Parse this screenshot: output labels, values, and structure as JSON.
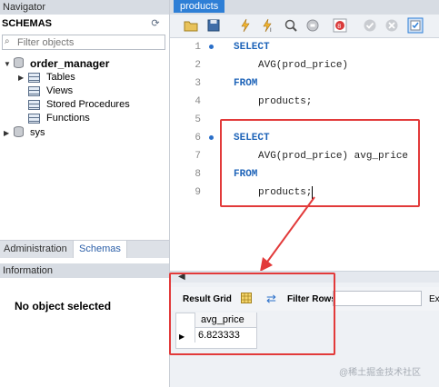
{
  "navigator": {
    "title": "Navigator",
    "schemas_label": "SCHEMAS",
    "filter_placeholder": "Filter objects",
    "tree": {
      "db_name": "order_manager",
      "children": [
        "Tables",
        "Views",
        "Stored Procedures",
        "Functions"
      ],
      "other_db": "sys"
    },
    "tabs": [
      "Administration",
      "Schemas"
    ],
    "info_title": "Information",
    "info_text": "No object selected"
  },
  "editor": {
    "tab_label": "products",
    "lines": [
      {
        "num": "1",
        "text": "SELECT"
      },
      {
        "num": "2",
        "text": "AVG(prod_price)"
      },
      {
        "num": "3",
        "text": "FROM"
      },
      {
        "num": "4",
        "text": "products;"
      },
      {
        "num": "5",
        "text": ""
      },
      {
        "num": "6",
        "text": "SELECT"
      },
      {
        "num": "7",
        "text": "AVG(prod_price) avg_price"
      },
      {
        "num": "8",
        "text": "FROM"
      },
      {
        "num": "9",
        "text": "products;"
      }
    ]
  },
  "result": {
    "result_grid_label": "Result Grid",
    "filter_rows_label": "Filter Rows:",
    "export_label": "Ex",
    "column": "avg_price",
    "value": "6.823333"
  },
  "watermark": "@稀土掘金技术社区",
  "colors": {
    "accent": "#2e7fd6",
    "keyword": "#1d63b8",
    "highlight": "#e23a3a"
  }
}
